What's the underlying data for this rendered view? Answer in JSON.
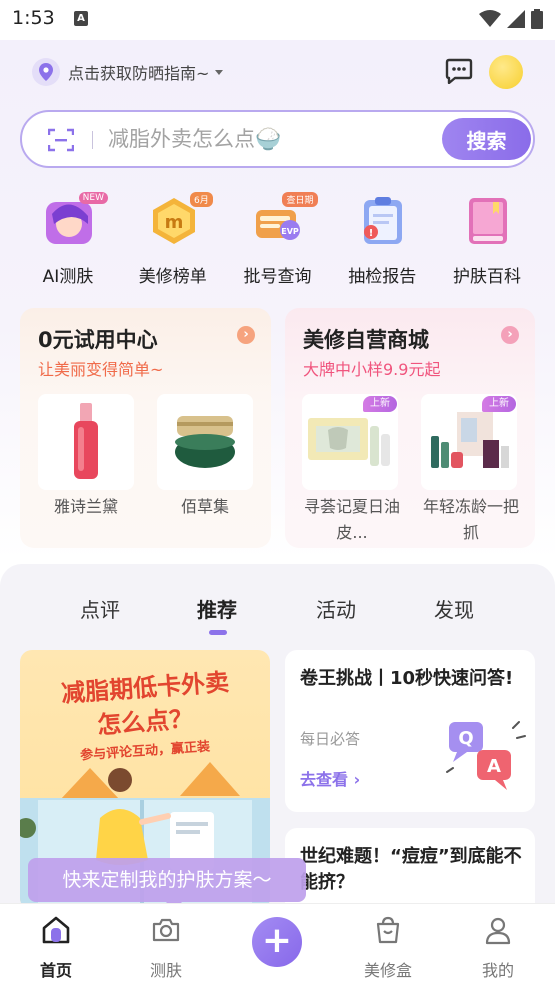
{
  "status_bar": {
    "time": "1:53"
  },
  "header": {
    "location_text": "点击获取防晒指南~"
  },
  "search": {
    "placeholder": "减脂外卖怎么点🍚",
    "button_label": "搜索"
  },
  "quick_links": [
    {
      "label": "AI测肤",
      "badge": "NEW",
      "icon": "ai-face-icon"
    },
    {
      "label": "美修榜单",
      "badge": "6月",
      "icon": "ranking-medal-icon"
    },
    {
      "label": "批号查询",
      "badge": "查日期",
      "icon": "batch-query-icon"
    },
    {
      "label": "抽检报告",
      "badge": "",
      "icon": "inspection-report-icon"
    },
    {
      "label": "护肤百科",
      "badge": "",
      "icon": "encyclopedia-book-icon"
    }
  ],
  "cards": {
    "trial": {
      "title": "0元试用中心",
      "subtitle": "让美丽变得简单~",
      "accent": "#f06b4a",
      "products": [
        {
          "name": "雅诗兰黛"
        },
        {
          "name": "佰草集"
        }
      ]
    },
    "mall": {
      "title": "美修自营商城",
      "subtitle": "大牌中小样9.9元起",
      "accent": "#f0557e",
      "products": [
        {
          "name": "寻荟记夏日油皮...",
          "tag": "上新"
        },
        {
          "name": "年轻冻龄一把抓",
          "tag": "上新"
        }
      ]
    }
  },
  "feed": {
    "tabs": [
      {
        "label": "点评",
        "active": false
      },
      {
        "label": "推荐",
        "active": true
      },
      {
        "label": "活动",
        "active": false
      },
      {
        "label": "发现",
        "active": false
      }
    ],
    "banner": {
      "line1": "减脂期低卡外卖",
      "line2": "怎么点？",
      "line3": "参与评论互动，赢正装"
    },
    "qa_card": {
      "title": "卷王挑战丨10秒快速问答!",
      "subtitle": "每日必答",
      "link": "去查看 ›"
    },
    "topic_card": {
      "title": "世纪难题！“痘痘”到底能不能挤？"
    }
  },
  "tooltip": "快来定制我的护肤方案～",
  "bottom_nav": [
    {
      "label": "首页",
      "active": true,
      "icon": "home-icon"
    },
    {
      "label": "测肤",
      "active": false,
      "icon": "camera-icon"
    },
    {
      "label": "",
      "active": false,
      "icon": "plus-icon"
    },
    {
      "label": "美修盒",
      "active": false,
      "icon": "shopping-bag-icon"
    },
    {
      "label": "我的",
      "active": false,
      "icon": "profile-icon"
    }
  ],
  "colors": {
    "primary": "#8c72ea",
    "trial_accent": "#f06b4a",
    "mall_accent": "#f0557e"
  }
}
